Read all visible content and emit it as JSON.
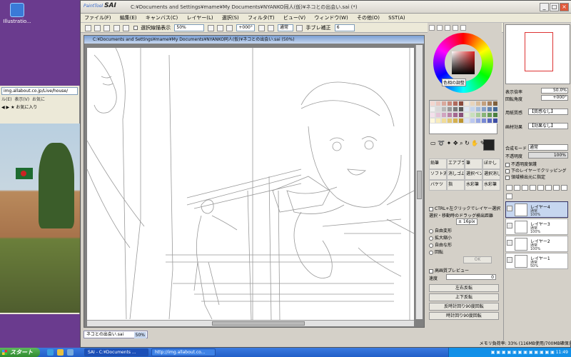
{
  "desktop": {
    "icon_label": "Illustratio...",
    "browser": {
      "address": "img.allabout.co.jp/Live/house/",
      "menu": [
        "ル(E)",
        "表示(V)",
        "お気に"
      ],
      "toolbar_label": "お気に入り"
    }
  },
  "window": {
    "logo_small": "PaintTool",
    "logo": "SAI",
    "title": "C:¥Documents and Settings¥mame¥My Documents¥NYANKO同人(仮)¥ネコとの出会い.sai (*)",
    "controls": [
      "_",
      "□",
      "×"
    ]
  },
  "menubar": [
    "ファイル(F)",
    "編集(E)",
    "キャンバス(C)",
    "レイヤー(L)",
    "選択(S)",
    "フィルタ(T)",
    "ビュー(V)",
    "ウィンドウ(W)",
    "その他(O)",
    "SST(A)"
  ],
  "toolbar": {
    "selection_checkbox": "選択線描表示",
    "zoom": "50%",
    "angle": "+000°",
    "mode": "通常",
    "stabilizer_label": "手ブレ補正",
    "stabilizer_value": "6"
  },
  "canvas": {
    "title": "C:¥Documents and Settings¥mame¥My Documents¥NYANKO同人(仮)¥ネコとの出会い.sai (50%)"
  },
  "doc_tab": {
    "name": "ネコとの出会い.sai",
    "zoom": "50%"
  },
  "color_panel": {
    "label": "色相の調整"
  },
  "tools": [
    "鉛筆",
    "エアブラシ",
    "筆",
    "ぼかし",
    "ソフト消",
    "消しゴム",
    "選択ペン",
    "選択消し",
    "バケツ",
    "指",
    "水彩筆",
    "水彩筆"
  ],
  "tool_options": {
    "ctrl_option": "CTRL+左クリックでレイヤー選択",
    "drag_label": "選択・移動時のドラッグ検出距離",
    "drag_value": "± 16pix",
    "radios": [
      "自由変形",
      "拡大縮小",
      "自由な形",
      "回転"
    ],
    "ok": "OK",
    "preview": "高画質プレビュー",
    "quality_label": "速度",
    "quality_value": "0",
    "buttons": [
      "左右反転",
      "上下反転",
      "反時計回り90度回転",
      "時計回り90度回転"
    ]
  },
  "navigator": {
    "zoom_label": "表示倍率",
    "zoom_value": "50.0%",
    "angle_label": "回転角度",
    "angle_value": "+000°"
  },
  "layer_panel": {
    "texture_label": "用紙質感",
    "texture_value": "【質感なし】",
    "effect_label": "画材効果",
    "effect_value": "【効果なし】",
    "blend_label": "合成モード",
    "blend_value": "通常",
    "opacity_label": "不透明度",
    "opacity_value": "100%",
    "checks": [
      "不透明度保護",
      "下のレイヤーでクリッピング",
      "領域検出元に指定"
    ],
    "layers": [
      {
        "name": "レイヤー4",
        "mode": "通常",
        "opacity": "100%",
        "selected": true
      },
      {
        "name": "レイヤー3",
        "mode": "通常",
        "opacity": "100%",
        "selected": false
      },
      {
        "name": "レイヤー2",
        "mode": "通常",
        "opacity": "100%",
        "selected": false
      },
      {
        "name": "レイヤー1",
        "mode": "通常",
        "opacity": "50%",
        "selected": false
      }
    ]
  },
  "status": "メモリ負荷率: 33% (116MB使用/700MB確保)",
  "taskbar": {
    "start": "スタート",
    "tasks": [
      "SAI - C:¥Documents ...",
      "http://img.allabout.co..."
    ],
    "time": "11:49"
  }
}
